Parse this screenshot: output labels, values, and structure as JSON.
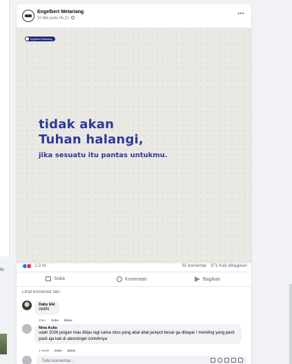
{
  "sidebar_fragment": {
    "text": "to"
  },
  "post": {
    "author": "Engelbert Metariang",
    "date": "16 Mei pada 06.21",
    "brand_tag": "Engelbert Metariang",
    "quote_line1": "tidak akan",
    "quote_line2": "Tuhan halangi,",
    "quote_line3": "jika sesuatu itu pantas untukmu.",
    "reaction_count": "2,3 rb",
    "stats": "92 komentar   371 Kali dibagikan",
    "actions": {
      "like": "Suka",
      "comment": "Komentari",
      "share": "Bagikan"
    },
    "view_more_comments": "Lihat komentar lain",
    "colors": {
      "accent": "#1877f2",
      "quote": "#2d3a9a",
      "love": "#f02849"
    }
  },
  "comments": [
    {
      "name": "Daby Ebi",
      "text": "AMIN",
      "time": "1hari",
      "like": "Suka",
      "reply": "Balas"
    },
    {
      "name": "Nina Aulia",
      "text": "udah 2026 jangan mau ditipu lagi sama situs yang abal abal jackpot besar ga dibayar ! mending yang pasti pasti aja kak di alexistogel contohnya",
      "time": "1 menit",
      "like": "Suka",
      "reply": "Balas"
    }
  ],
  "composer": {
    "placeholder": "Tulis komentar..."
  }
}
